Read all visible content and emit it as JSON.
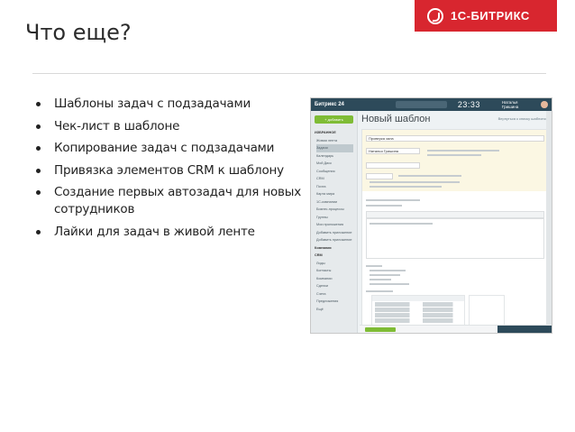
{
  "slide": {
    "title": "Что еще?",
    "brand": "1С-БИТРИКС"
  },
  "bullets": [
    "Шаблоны задач с подзадачами",
    "Чек-лист  в шаблоне",
    "Копирование задач с подзадачами",
    "Привязка элементов CRM к шаблону",
    "Создание первых автозадач для новых сотрудников",
    "Лайки для задач в живой ленте"
  ],
  "screenshot": {
    "app_name": "Битрикс 24",
    "clock": "23:33",
    "user_name": "Наталья Гришина",
    "add_button": "+ добавить",
    "page_title": "Новый шаблон",
    "page_link": "Вернуться к списку шаблонов",
    "task_title": "Проверка зала",
    "responsible": "Наталья Гришина",
    "sidebar_items": [
      "ИЗБРАННОЕ",
      "Живая лента",
      "Задачи",
      "Календарь",
      "Мой Диск",
      "Сообщения",
      "CRM",
      "Почта",
      "Карта мира",
      "1С-компании",
      "Бизнес-процессы",
      "Группы",
      "Мои приложения",
      "Добавить приложение",
      "Добавить приложение",
      "Компания",
      "CRM",
      "Лиды",
      "Контакты",
      "Компании",
      "Сделки",
      "Счета",
      "Предложения",
      "Ещё"
    ]
  }
}
